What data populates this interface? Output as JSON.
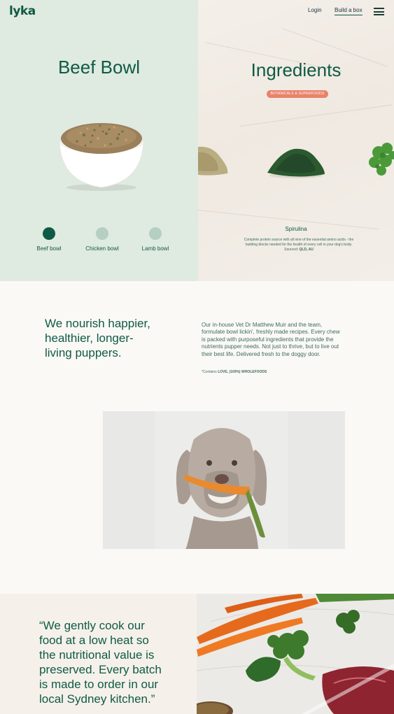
{
  "brand": {
    "logo": "lyka"
  },
  "nav": {
    "login": "Login",
    "build_box": "Build a box",
    "menu_icon": "hamburger-menu-icon"
  },
  "bowl": {
    "title": "Beef Bowl",
    "tabs": [
      {
        "label": "Beef bowl",
        "active": true,
        "icon": "beef-icon"
      },
      {
        "label": "Chicken bowl",
        "active": false,
        "icon": "chicken-icon"
      },
      {
        "label": "Lamb bowl",
        "active": false,
        "icon": "lamb-icon"
      }
    ]
  },
  "ingredients": {
    "title": "Ingredients",
    "badge": "BOTANICALS & SUPERFOODS",
    "current": {
      "name": "Spirulina",
      "description": "Complete protein source with all nine of the essential amino acids - the building blocks needed for the health of every cell in your dog's body.  Sourced:",
      "source": "QLD, AU"
    }
  },
  "nourish": {
    "heading": "We nourish happier, healthier, longer-living puppers.",
    "body": "Our in-house Vet Dr Matthew Muir and the team, formulate bowl lickin', freshly made recipes. Every chew is packed with purposeful ingredients that provide the nutrients pupper needs. Not just to thrive, but to live out their best life. Delivered fresh to the doggy door.",
    "footnote_prefix": "*Contains",
    "footnote_bold": "LOVE, (100%) WHOLEFOODS"
  },
  "quote": {
    "text": "“We gently cook our food at a low heat so the nutritional value is preserved. Every batch is made to order in our local Sydney kitchen.”"
  },
  "colors": {
    "brand_green": "#0f5a45",
    "hero_left_bg": "#dfeae0",
    "badge_bg": "#e98269",
    "page_bg": "#fbf9f6"
  }
}
